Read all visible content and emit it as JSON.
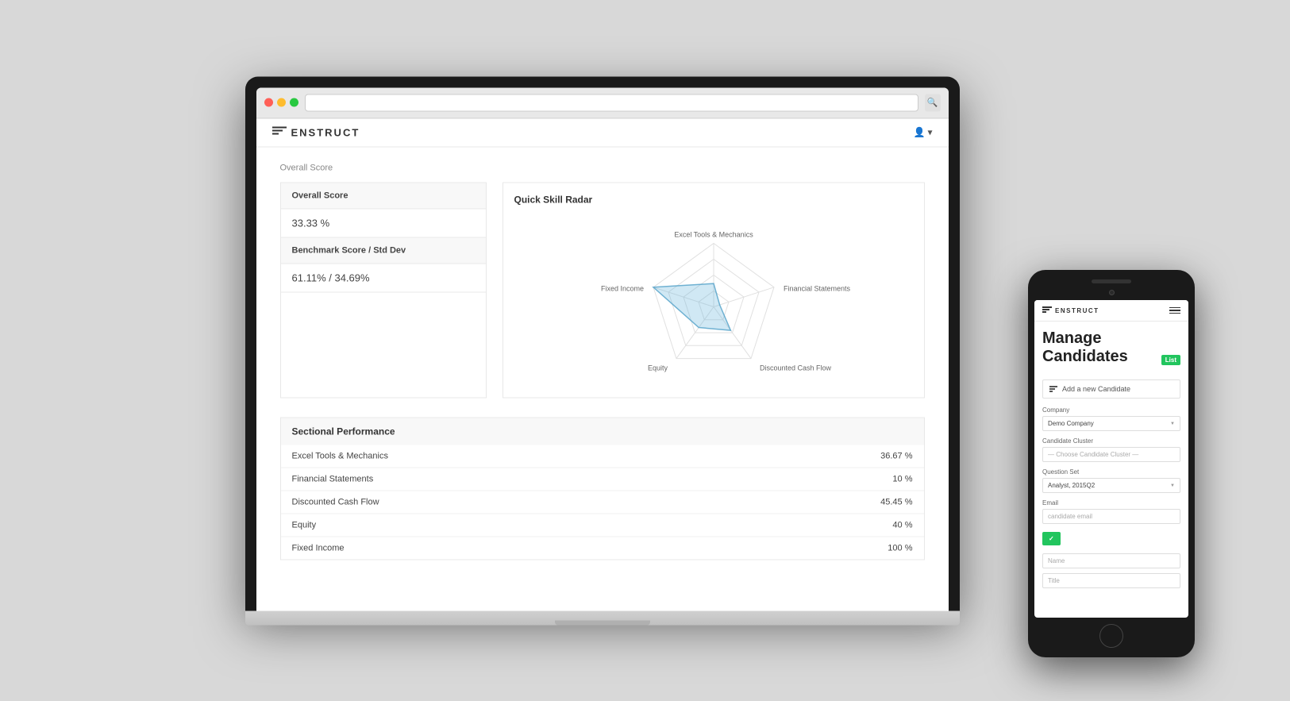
{
  "scene": {
    "background_color": "#d8d8d8"
  },
  "laptop": {
    "browser": {
      "traffic_lights": [
        "red",
        "yellow",
        "green"
      ],
      "url_bar_placeholder": ""
    },
    "app": {
      "logo_text": "ENSTRUCT",
      "user_menu_label": "▾",
      "overall_score_label": "Overall Score",
      "overall_score_value": "33.33 %",
      "benchmark_label": "Benchmark Score / Std Dev",
      "benchmark_value": "61.11% / 34.69%",
      "radar_title": "Quick Skill Radar",
      "radar_labels": {
        "top": "Excel Tools & Mechanics",
        "right_top": "Financial Statements",
        "right_bottom": "Discounted Cash Flow",
        "bottom": "Equity",
        "left": "Fixed Income"
      },
      "sectional_title": "Sectional Performance",
      "sectional_rows": [
        {
          "label": "Excel Tools & Mechanics",
          "value": "36.67 %"
        },
        {
          "label": "Financial Statements",
          "value": "10 %"
        },
        {
          "label": "Discounted Cash Flow",
          "value": "45.45 %"
        },
        {
          "label": "Equity",
          "value": "40 %"
        },
        {
          "label": "Fixed Income",
          "value": "100 %"
        }
      ]
    }
  },
  "phone": {
    "logo_text": "ENSTRUCT",
    "menu_icon_label": "☰",
    "page_title": "Manage Candidates",
    "list_badge": "List",
    "add_candidate_label": "Add a new Candidate",
    "company_label": "Company",
    "company_value": "Demo Company",
    "candidate_cluster_label": "Candidate Cluster",
    "candidate_cluster_placeholder": "— Choose Candidate Cluster —",
    "question_set_label": "Question Set",
    "question_set_value": "Analyst, 2015Q2",
    "email_label": "Email",
    "email_placeholder": "candidate email",
    "submit_button_label": "✓",
    "name_placeholder": "Name",
    "title_placeholder": "Title"
  }
}
